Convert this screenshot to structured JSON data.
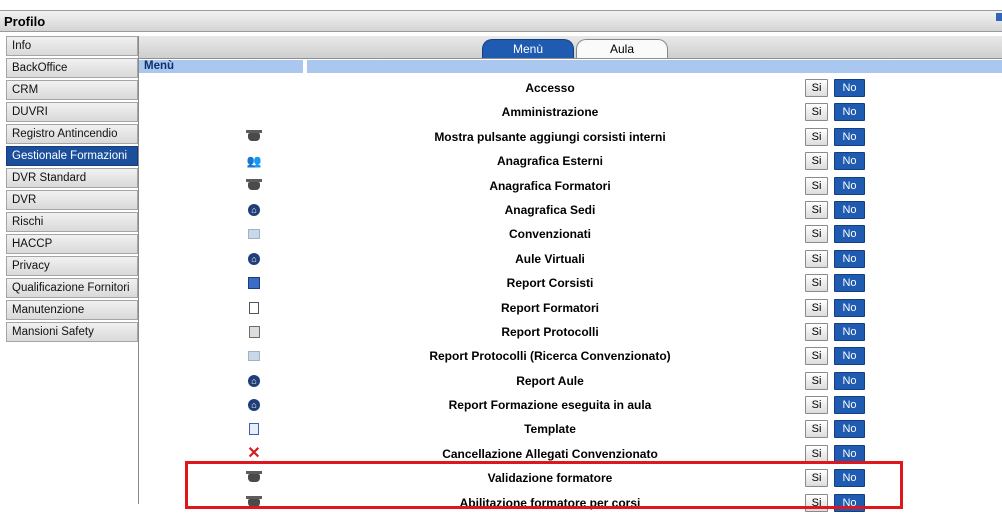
{
  "window": {
    "title": "Profilo"
  },
  "sidebar": {
    "items": [
      {
        "label": "Info",
        "active": false
      },
      {
        "label": "BackOffice",
        "active": false
      },
      {
        "label": "CRM",
        "active": false
      },
      {
        "label": "DUVRI",
        "active": false
      },
      {
        "label": "Registro Antincendio",
        "active": false
      },
      {
        "label": "Gestionale Formazioni",
        "active": true
      },
      {
        "label": "DVR Standard",
        "active": false
      },
      {
        "label": "DVR",
        "active": false
      },
      {
        "label": "Rischi",
        "active": false
      },
      {
        "label": "HACCP",
        "active": false
      },
      {
        "label": "Privacy",
        "active": false
      },
      {
        "label": "Qualificazione Fornitori",
        "active": false
      },
      {
        "label": "Manutenzione",
        "active": false
      },
      {
        "label": "Mansioni Safety",
        "active": false
      }
    ]
  },
  "tabs": [
    {
      "label": "Menù",
      "active": true
    },
    {
      "label": "Aula",
      "active": false
    }
  ],
  "section": {
    "label": "Menù"
  },
  "buttons": {
    "si": "Si",
    "no": "No"
  },
  "rows": [
    {
      "label": "Accesso",
      "icon": "none"
    },
    {
      "label": "Amministrazione",
      "icon": "none"
    },
    {
      "label": "Mostra pulsante aggiungi corsisti interni",
      "icon": "graduation-cap-icon"
    },
    {
      "label": "Anagrafica Esterni",
      "icon": "people-icon"
    },
    {
      "label": "Anagrafica Formatori",
      "icon": "graduation-cap-icon"
    },
    {
      "label": "Anagrafica Sedi",
      "icon": "house-icon"
    },
    {
      "label": "Convenzionati",
      "icon": "handshake-icon"
    },
    {
      "label": "Aule Virtuali",
      "icon": "house-icon"
    },
    {
      "label": "Report Corsisti",
      "icon": "id-cards-icon"
    },
    {
      "label": "Report Formatori",
      "icon": "calculator-icon"
    },
    {
      "label": "Report Protocolli",
      "icon": "report-icon"
    },
    {
      "label": "Report Protocolli (Ricerca Convenzionato)",
      "icon": "handshake-icon"
    },
    {
      "label": "Report Aule",
      "icon": "house-icon"
    },
    {
      "label": "Report Formazione eseguita in aula",
      "icon": "house-icon"
    },
    {
      "label": "Template",
      "icon": "document-icon"
    },
    {
      "label": "Cancellazione Allegati Convenzionato",
      "icon": "delete-x-icon"
    },
    {
      "label": "Validazione formatore",
      "icon": "graduation-cap-icon"
    },
    {
      "label": "Abilitazione formatore per corsi",
      "icon": "graduation-cap-icon"
    }
  ],
  "colors": {
    "accent": "#1f5bb0",
    "highlight": "#e0161d",
    "section": "#a9c7ef"
  }
}
